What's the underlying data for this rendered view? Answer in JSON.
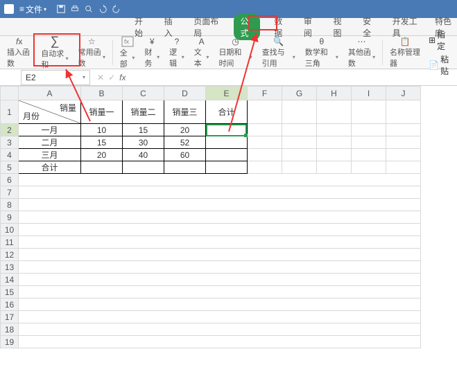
{
  "titlebar": {
    "file_label": "文件"
  },
  "tabs": {
    "start": "开始",
    "insert": "插入",
    "layout": "页面布局",
    "formula": "公式",
    "data": "数据",
    "review": "审阅",
    "view": "视图",
    "security": "安全",
    "dev": "开发工具",
    "special": "特色应"
  },
  "ribbon": {
    "insert_fn": "插入函数",
    "autosum": "自动求和",
    "common": "常用函数",
    "all": "全部",
    "finance": "财务",
    "logic": "逻辑",
    "text": "文本",
    "datetime": "日期和时间",
    "lookup": "查找与引用",
    "math": "数学和三角",
    "other": "其他函数",
    "name_mgr": "名称管理器",
    "paste_name": "粘贴",
    "define": "指定"
  },
  "namebox": {
    "value": "E2"
  },
  "headers": {
    "diag_top": "销量",
    "diag_bottom": "月份",
    "c1": "销量一",
    "c2": "销量二",
    "c3": "销量三",
    "total": "合计"
  },
  "rows": {
    "r1": {
      "m": "一月",
      "v1": "10",
      "v2": "15",
      "v3": "20"
    },
    "r2": {
      "m": "二月",
      "v1": "15",
      "v2": "30",
      "v3": "52"
    },
    "r3": {
      "m": "三月",
      "v1": "20",
      "v2": "40",
      "v3": "60"
    },
    "total": "合计"
  },
  "cols": [
    "A",
    "B",
    "C",
    "D",
    "E",
    "F",
    "G",
    "H",
    "I",
    "J"
  ]
}
